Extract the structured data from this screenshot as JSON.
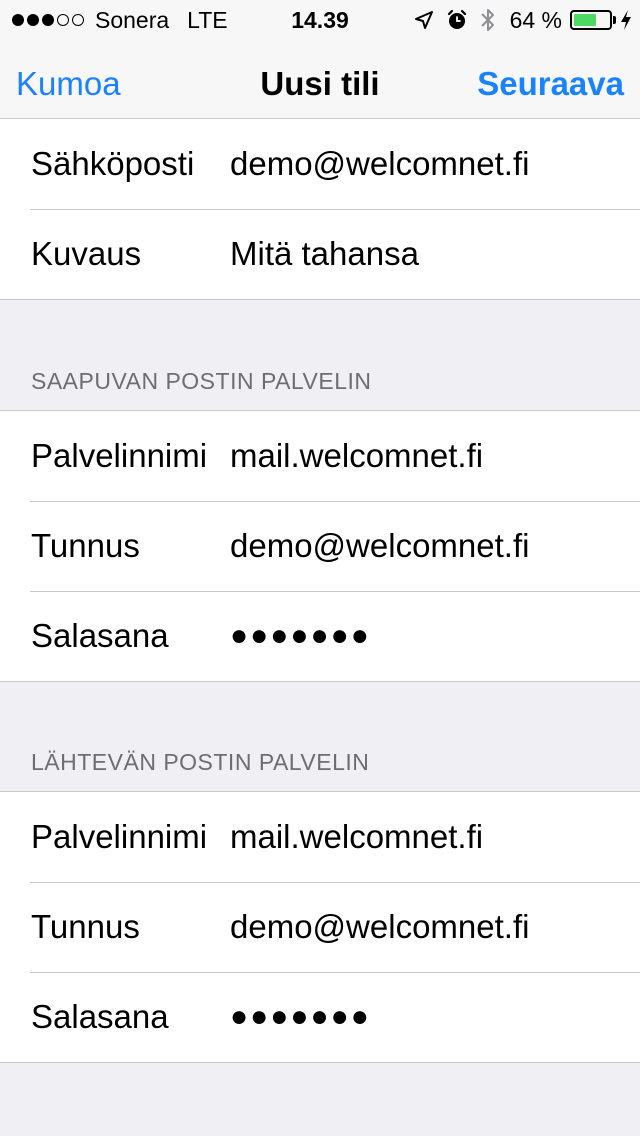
{
  "status_bar": {
    "carrier": "Sonera",
    "network": "LTE",
    "time": "14.39",
    "battery_percent": "64 %",
    "battery_level": 0.64,
    "signal_bars_full": 3,
    "signal_bars_total": 5,
    "icons": [
      "location-arrow-icon",
      "alarm-clock-icon",
      "bluetooth-icon",
      "battery-icon",
      "charging-bolt-icon"
    ]
  },
  "nav": {
    "cancel_label": "Kumoa",
    "title": "Uusi tili",
    "next_label": "Seuraava",
    "accent_color": "#1a82fb"
  },
  "account": {
    "rows": [
      {
        "label": "Sähköposti",
        "value": "demo@welcomnet.fi"
      },
      {
        "label": "Kuvaus",
        "value": "Mitä tahansa"
      }
    ]
  },
  "incoming": {
    "header": "SAAPUVAN POSTIN PALVELIN",
    "rows": [
      {
        "label": "Palvelinnimi",
        "value": "mail.welcomnet.fi"
      },
      {
        "label": "Tunnus",
        "value": "demo@welcomnet.fi"
      },
      {
        "label": "Salasana",
        "value": "●●●●●●●"
      }
    ]
  },
  "outgoing": {
    "header": "LÄHTEVÄN POSTIN PALVELIN",
    "rows": [
      {
        "label": "Palvelinnimi",
        "value": "mail.welcomnet.fi"
      },
      {
        "label": "Tunnus",
        "value": "demo@welcomnet.fi"
      },
      {
        "label": "Salasana",
        "value": "●●●●●●●"
      }
    ]
  }
}
